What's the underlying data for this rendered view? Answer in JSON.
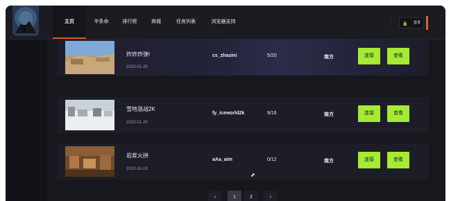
{
  "nav": {
    "items": [
      "主页",
      "半条命",
      "排行榜",
      "商城",
      "任务列表",
      "浏览器支持"
    ],
    "active_index": 0,
    "login_label": "登录"
  },
  "servers": [
    {
      "name": "炸炸炸弹!",
      "date": "2023-01-20",
      "map": "cs_zhasini",
      "players": "5/20",
      "region": "南方",
      "join": "连接",
      "view": "查看"
    },
    {
      "name": "雪地混战2K",
      "date": "2023-01-20",
      "map": "fy_iceworld2k",
      "players": "9/16",
      "region": "南方",
      "join": "连接",
      "view": "查看"
    },
    {
      "name": "岩浆火拼",
      "date": "2022-10-19",
      "map": "aAa_aim",
      "players": "0/12",
      "region": "南方",
      "join": "连接",
      "view": "查看"
    }
  ],
  "pagination": {
    "prev": "‹",
    "pages": [
      "1",
      "2"
    ],
    "current": "1",
    "next": "›"
  },
  "colors": {
    "accent": "#a6eb33",
    "nav_underline": "#d25a2a",
    "background": "#121219"
  },
  "icons": [
    "lock-icon",
    "chevron-left-icon",
    "chevron-right-icon",
    "cursor-icon"
  ]
}
